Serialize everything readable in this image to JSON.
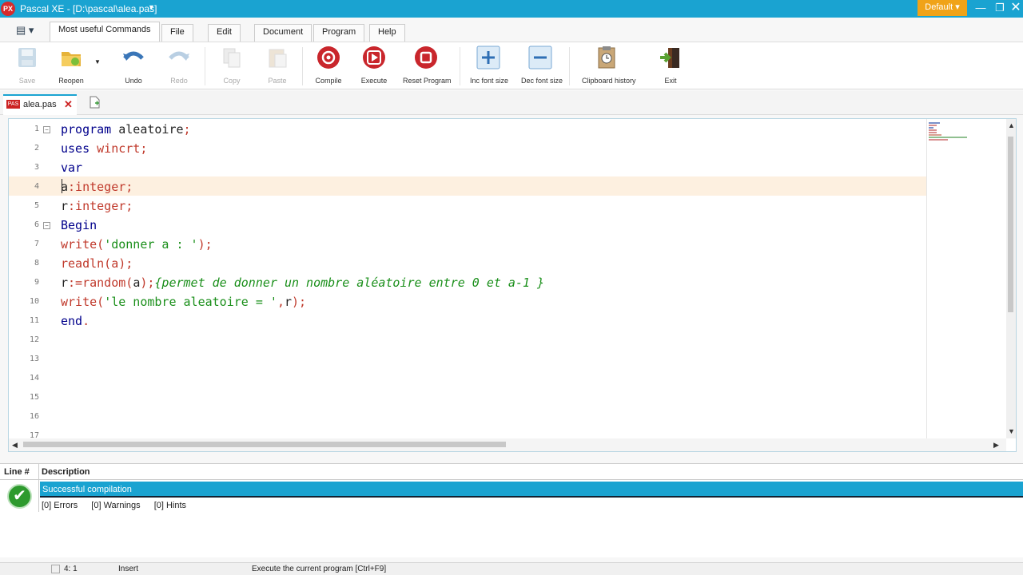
{
  "window": {
    "title": "Pascal XE  -  [D:\\pascal\\alea.pas]",
    "logo": "PX",
    "theme": "Default",
    "controls": {
      "minimize": "—",
      "maximize": "❐",
      "close": "✕"
    }
  },
  "ribbon": {
    "tabs": [
      {
        "label": "Most useful Commands",
        "active": true
      },
      {
        "label": "File"
      },
      {
        "label": "Edit"
      },
      {
        "label": "Document"
      },
      {
        "label": "Program"
      },
      {
        "label": "Help"
      }
    ],
    "buttons": [
      {
        "label": "Save",
        "icon": "save-icon",
        "enabled": false
      },
      {
        "label": "Reopen",
        "icon": "folder-icon",
        "enabled": true
      },
      {
        "label": "Undo",
        "icon": "undo-icon",
        "enabled": true
      },
      {
        "label": "Redo",
        "icon": "redo-icon",
        "enabled": false
      },
      {
        "label": "Copy",
        "icon": "copy-icon",
        "enabled": false
      },
      {
        "label": "Paste",
        "icon": "paste-icon",
        "enabled": false
      },
      {
        "label": "Compile",
        "icon": "compile-icon",
        "enabled": true
      },
      {
        "label": "Execute",
        "icon": "play-icon",
        "enabled": true
      },
      {
        "label": "Reset Program",
        "icon": "stop-icon",
        "enabled": true
      },
      {
        "label": "Inc font size",
        "icon": "plus-icon",
        "enabled": true
      },
      {
        "label": "Dec font size",
        "icon": "minus-icon",
        "enabled": true
      },
      {
        "label": "Clipboard history",
        "icon": "clipboard-clock-icon",
        "enabled": true
      },
      {
        "label": "Exit",
        "icon": "exit-door-icon",
        "enabled": true
      }
    ]
  },
  "document_tab": {
    "label": "alea.pas",
    "icon_text": "PAS",
    "close": "✕"
  },
  "editor": {
    "line_numbers": [
      "1",
      "2",
      "3",
      "4",
      "5",
      "6",
      "7",
      "8",
      "9",
      "10",
      "11",
      "12",
      "13",
      "14",
      "15",
      "16",
      "17"
    ],
    "lines": [
      [
        [
          "kw",
          "program"
        ],
        [
          "id",
          " aleatoire"
        ],
        [
          "op",
          ";"
        ]
      ],
      [
        [
          "kw",
          "uses"
        ],
        [
          "op",
          " wincrt;"
        ]
      ],
      [
        [
          "kw",
          "var"
        ]
      ],
      [
        [
          "id",
          "a"
        ],
        [
          "op",
          ":integer;"
        ]
      ],
      [
        [
          "id",
          "r"
        ],
        [
          "op",
          ":integer;"
        ]
      ],
      [
        [
          "kw",
          "Begin"
        ]
      ],
      [
        [
          "op",
          "write("
        ],
        [
          "str",
          "'donner a : '"
        ],
        [
          "op",
          ");"
        ]
      ],
      [
        [
          "op",
          "readln(a);"
        ]
      ],
      [
        [
          "id",
          "r"
        ],
        [
          "op",
          ":=random("
        ],
        [
          "id",
          "a"
        ],
        [
          "op",
          ");"
        ],
        [
          "cmt",
          "{permet de donner un nombre aléatoire entre 0 et a-1 }"
        ]
      ],
      [
        [
          "op",
          "write("
        ],
        [
          "str",
          "'le nombre aleatoire = '"
        ],
        [
          "op",
          ","
        ],
        [
          "id",
          "r"
        ],
        [
          "op",
          ");"
        ]
      ],
      [
        [
          "kw",
          "end"
        ],
        [
          "op",
          "."
        ]
      ]
    ],
    "current_line": 4,
    "folds": [
      1,
      6
    ]
  },
  "messages": {
    "columns": {
      "line": "Line #",
      "description": "Description"
    },
    "status": "Successful compilation",
    "errors": "[0] Errors",
    "warnings": "[0] Warnings",
    "hints": "[0] Hints"
  },
  "statusbar": {
    "position": "4: 1",
    "mode": "Insert",
    "hint": "Execute the current program  [Ctrl+F9]"
  },
  "colors": {
    "accent": "#1aa3d1",
    "theme_button": "#f0a318",
    "current_line": "#fdf0e0",
    "success": "#2e9a2e"
  }
}
